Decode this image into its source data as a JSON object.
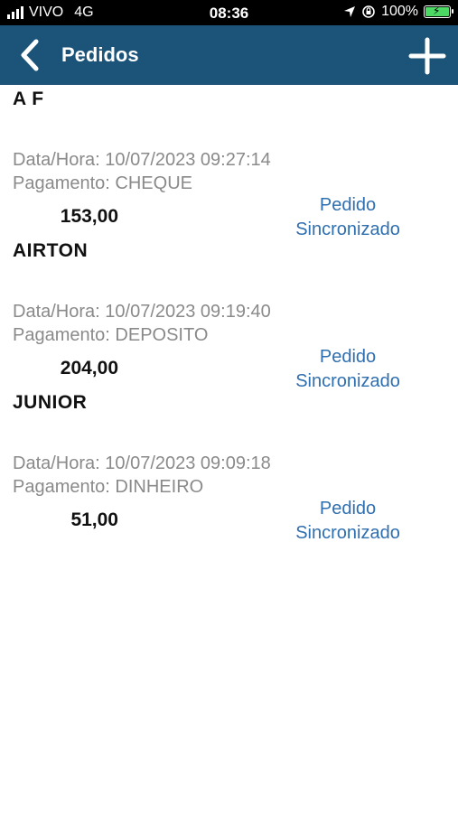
{
  "status_bar": {
    "carrier": "VIVO",
    "network": "4G",
    "time": "08:36",
    "battery": "100%"
  },
  "nav": {
    "title": "Pedidos"
  },
  "orders": [
    {
      "header_name": "A F",
      "datetime_label": "Data/Hora: 10/07/2023 09:27:14",
      "payment_label": "Pagamento: CHEQUE",
      "amount": "153,00",
      "status": "Pedido Sincronizado"
    },
    {
      "header_name": "AIRTON",
      "datetime_label": "Data/Hora: 10/07/2023 09:19:40",
      "payment_label": "Pagamento: DEPOSITO",
      "amount": "204,00",
      "status": "Pedido Sincronizado"
    },
    {
      "header_name": "JUNIOR",
      "datetime_label": "Data/Hora: 10/07/2023 09:09:18",
      "payment_label": "Pagamento: DINHEIRO",
      "amount": "51,00",
      "status": "Pedido Sincronizado"
    }
  ],
  "colors": {
    "nav_bg": "#1c5479",
    "status_link": "#2f6fb0",
    "secondary_text": "#8a8a8a"
  }
}
